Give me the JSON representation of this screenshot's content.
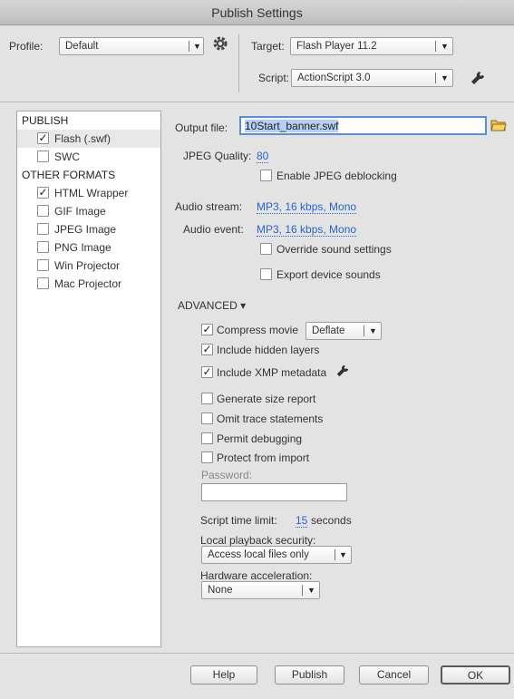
{
  "window": {
    "title": "Publish Settings"
  },
  "header": {
    "profile_label": "Profile:",
    "profile_value": "Default",
    "target_label": "Target:",
    "target_value": "Flash Player 11.2",
    "script_label": "Script:",
    "script_value": "ActionScript 3.0"
  },
  "sidebar": {
    "publish_header": "PUBLISH",
    "publish_items": [
      {
        "label": "Flash (.swf)",
        "checked": true
      },
      {
        "label": "SWC",
        "checked": false
      }
    ],
    "other_header": "OTHER FORMATS",
    "other_items": [
      {
        "label": "HTML Wrapper",
        "checked": true
      },
      {
        "label": "GIF Image",
        "checked": false
      },
      {
        "label": "JPEG Image",
        "checked": false
      },
      {
        "label": "PNG Image",
        "checked": false
      },
      {
        "label": "Win Projector",
        "checked": false
      },
      {
        "label": "Mac Projector",
        "checked": false
      }
    ]
  },
  "main": {
    "output_file_label": "Output file:",
    "output_file_value": "10Start_banner.swf",
    "jpeg_quality_label": "JPEG Quality:",
    "jpeg_quality_value": "80",
    "jpeg_deblocking_label": "Enable JPEG deblocking",
    "audio_stream_label": "Audio stream:",
    "audio_stream_value": "MP3, 16 kbps, Mono",
    "audio_event_label": "Audio event:",
    "audio_event_value": "MP3, 16 kbps, Mono",
    "override_sound_label": "Override sound settings",
    "export_device_sounds_label": "Export device sounds",
    "advanced_label": "ADVANCED ▾",
    "compress_movie_label": "Compress movie",
    "compress_value": "Deflate",
    "include_hidden_layers_label": "Include hidden layers",
    "include_xmp_label": "Include XMP metadata",
    "generate_size_report_label": "Generate size report",
    "omit_trace_label": "Omit trace statements",
    "permit_debugging_label": "Permit debugging",
    "protect_import_label": "Protect from import",
    "password_label": "Password:",
    "password_value": "",
    "script_time_limit_label": "Script time limit:",
    "script_time_limit_value": "15",
    "script_time_limit_unit": "seconds",
    "local_playback_label": "Local playback security:",
    "local_playback_value": "Access local files only",
    "hardware_accel_label": "Hardware acceleration:",
    "hardware_accel_value": "None"
  },
  "footer": {
    "help": "Help",
    "publish": "Publish",
    "cancel": "Cancel",
    "ok": "OK"
  },
  "colors": {
    "link": "#2b63c9",
    "accent_border": "#5a8fd6",
    "selected_row": "#e8e8e8"
  }
}
